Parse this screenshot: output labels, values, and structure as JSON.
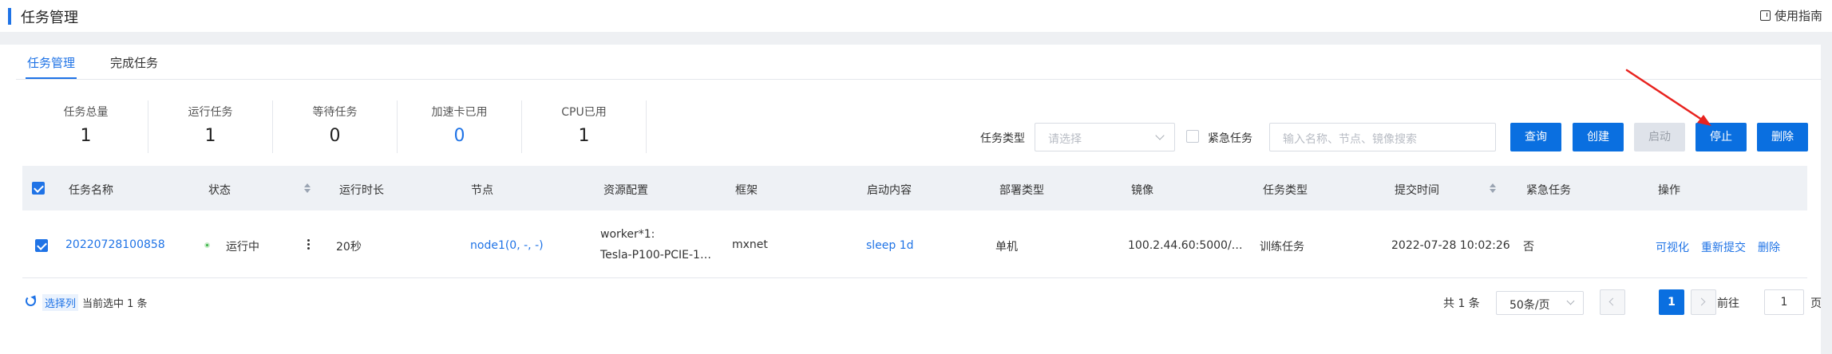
{
  "header": {
    "title": "任务管理",
    "guide_label": "使用指南"
  },
  "tabs": [
    {
      "label": "任务管理",
      "active": true
    },
    {
      "label": "完成任务",
      "active": false
    }
  ],
  "stats": [
    {
      "label": "任务总量",
      "value": "1"
    },
    {
      "label": "运行任务",
      "value": "1"
    },
    {
      "label": "等待任务",
      "value": "0"
    },
    {
      "label": "加速卡已用",
      "value": "0"
    },
    {
      "label": "CPU已用",
      "value": "1"
    }
  ],
  "filter": {
    "type_label": "任务类型",
    "type_placeholder": "请选择",
    "urgent_label": "紧急任务",
    "search_placeholder": "输入名称、节点、镜像搜索"
  },
  "buttons": {
    "query": "查询",
    "create": "创建",
    "start": "启动",
    "stop": "停止",
    "delete": "删除"
  },
  "table": {
    "columns": [
      "任务名称",
      "状态",
      "运行时长",
      "节点",
      "资源配置",
      "框架",
      "启动内容",
      "部署类型",
      "镜像",
      "任务类型",
      "提交时间",
      "紧急任务",
      "操作"
    ],
    "rows": [
      {
        "name": "20220728100858",
        "status": "运行中",
        "duration": "20秒",
        "node": "node1(0, -, -)",
        "resource_line1": "worker*1:",
        "resource_line2": "Tesla-P100-PCIE-1…",
        "framework": "mxnet",
        "start_content": "sleep 1d",
        "deploy_type": "单机",
        "image": "100.2.44.60:5000/…",
        "task_type": "训练任务",
        "submit_time": "2022-07-28 10:02:26",
        "urgent": "否",
        "actions": [
          "可视化",
          "重新提交",
          "删除"
        ]
      }
    ]
  },
  "footer": {
    "select_columns": "选择列",
    "selected_info": "当前选中 1 条",
    "total": "共 1 条",
    "page_size": "50条/页",
    "current_page": "1",
    "goto_label": "前往",
    "goto_value": "1",
    "page_unit": "页"
  },
  "colors": {
    "accent": "#1f73e6",
    "button": "#0a6fe0",
    "running": "#3bb34a",
    "annotation": "#e8231f"
  }
}
